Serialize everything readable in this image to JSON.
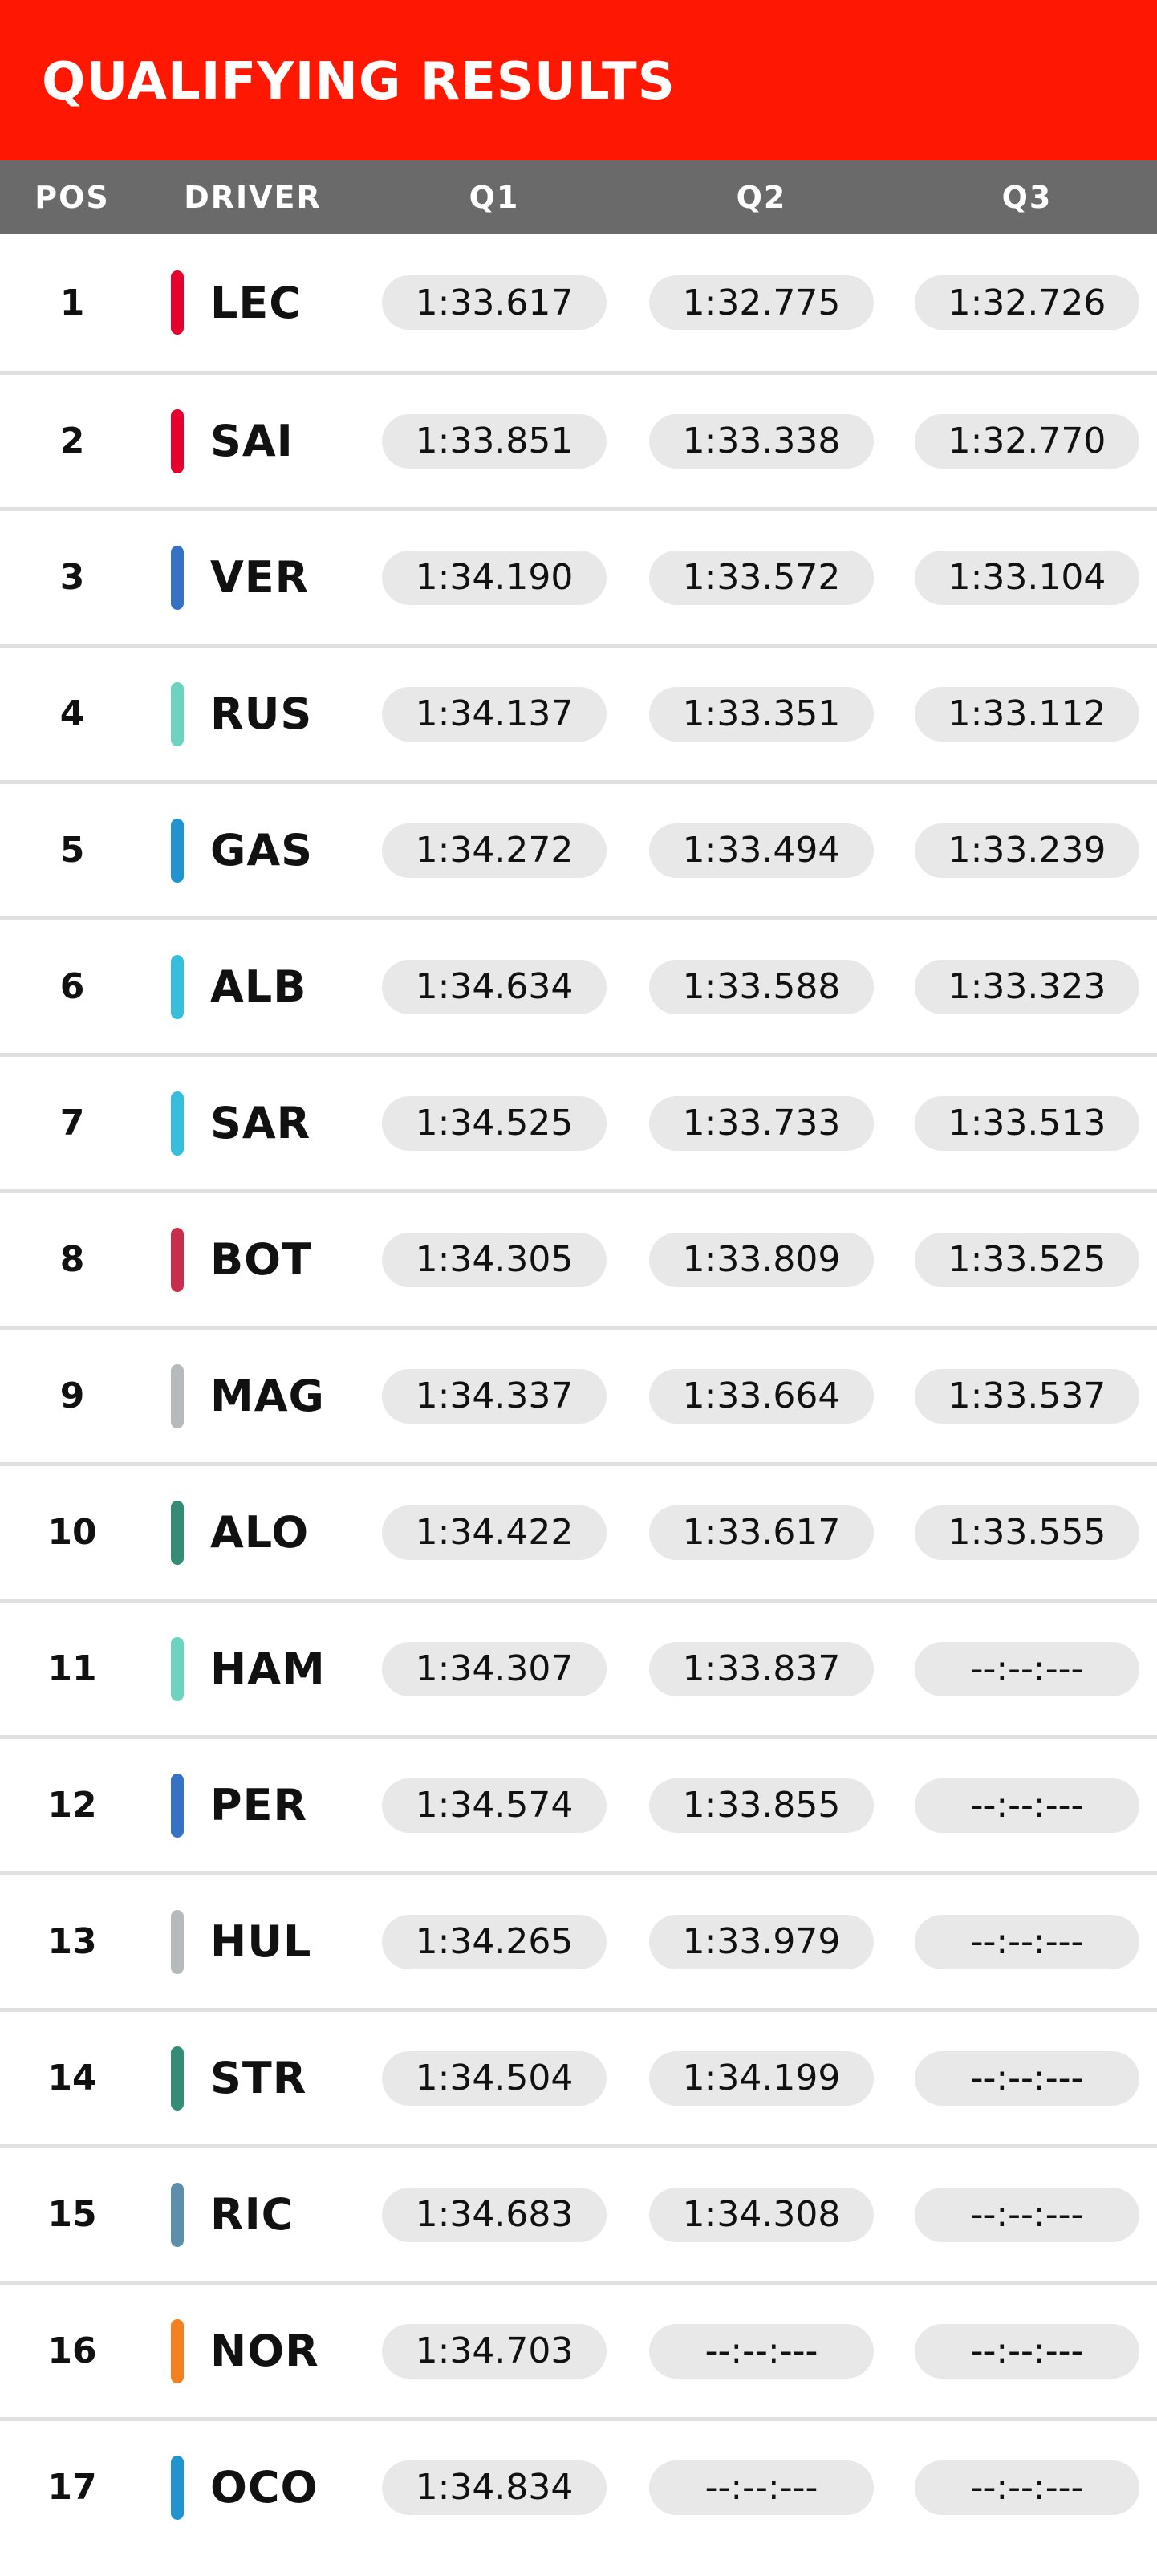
{
  "header": {
    "title": "QUALIFYING RESULTS"
  },
  "columns": {
    "pos": "POS",
    "driver": "DRIVER",
    "q1": "Q1",
    "q2": "Q2",
    "q3": "Q3"
  },
  "colors": {
    "header_bg": "#ff1801",
    "column_header_bg": "#6a6a6a",
    "pill_bg": "#e8e8e8"
  },
  "rows": [
    {
      "pos": "1",
      "driver": "LEC",
      "team_color": "#e8002d",
      "q1": "1:33.617",
      "q2": "1:32.775",
      "q3": "1:32.726"
    },
    {
      "pos": "2",
      "driver": "SAI",
      "team_color": "#e8002d",
      "q1": "1:33.851",
      "q2": "1:33.338",
      "q3": "1:32.770"
    },
    {
      "pos": "3",
      "driver": "VER",
      "team_color": "#3671c6",
      "q1": "1:34.190",
      "q2": "1:33.572",
      "q3": "1:33.104"
    },
    {
      "pos": "4",
      "driver": "RUS",
      "team_color": "#6cd3bf",
      "q1": "1:34.137",
      "q2": "1:33.351",
      "q3": "1:33.112"
    },
    {
      "pos": "5",
      "driver": "GAS",
      "team_color": "#2293d1",
      "q1": "1:34.272",
      "q2": "1:33.494",
      "q3": "1:33.239"
    },
    {
      "pos": "6",
      "driver": "ALB",
      "team_color": "#37bedd",
      "q1": "1:34.634",
      "q2": "1:33.588",
      "q3": "1:33.323"
    },
    {
      "pos": "7",
      "driver": "SAR",
      "team_color": "#37bedd",
      "q1": "1:34.525",
      "q2": "1:33.733",
      "q3": "1:33.513"
    },
    {
      "pos": "8",
      "driver": "BOT",
      "team_color": "#c92d4b",
      "q1": "1:34.305",
      "q2": "1:33.809",
      "q3": "1:33.525"
    },
    {
      "pos": "9",
      "driver": "MAG",
      "team_color": "#b6babd",
      "q1": "1:34.337",
      "q2": "1:33.664",
      "q3": "1:33.537"
    },
    {
      "pos": "10",
      "driver": "ALO",
      "team_color": "#358c75",
      "q1": "1:34.422",
      "q2": "1:33.617",
      "q3": "1:33.555"
    },
    {
      "pos": "11",
      "driver": "HAM",
      "team_color": "#6cd3bf",
      "q1": "1:34.307",
      "q2": "1:33.837",
      "q3": "--:--:---"
    },
    {
      "pos": "12",
      "driver": "PER",
      "team_color": "#3671c6",
      "q1": "1:34.574",
      "q2": "1:33.855",
      "q3": "--:--:---"
    },
    {
      "pos": "13",
      "driver": "HUL",
      "team_color": "#b6babd",
      "q1": "1:34.265",
      "q2": "1:33.979",
      "q3": "--:--:---"
    },
    {
      "pos": "14",
      "driver": "STR",
      "team_color": "#358c75",
      "q1": "1:34.504",
      "q2": "1:34.199",
      "q3": "--:--:---"
    },
    {
      "pos": "15",
      "driver": "RIC",
      "team_color": "#5e8faa",
      "q1": "1:34.683",
      "q2": "1:34.308",
      "q3": "--:--:---"
    },
    {
      "pos": "16",
      "driver": "NOR",
      "team_color": "#f58020",
      "q1": "1:34.703",
      "q2": "--:--:---",
      "q3": "--:--:---"
    },
    {
      "pos": "17",
      "driver": "OCO",
      "team_color": "#2293d1",
      "q1": "1:34.834",
      "q2": "--:--:---",
      "q3": "--:--:---"
    }
  ]
}
